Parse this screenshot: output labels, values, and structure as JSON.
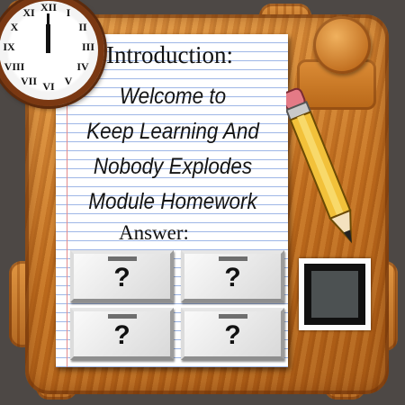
{
  "clock": {
    "numerals": [
      "XII",
      "I",
      "II",
      "III",
      "IV",
      "V",
      "VI",
      "VII",
      "VIII",
      "IX",
      "X",
      "XI"
    ]
  },
  "title": "Introduction:",
  "module_lines": [
    "Welcome to",
    "Keep Learning And",
    "Nobody Explodes",
    "Module Homework"
  ],
  "answer_label": "Answer:",
  "answers": [
    {
      "glyph": "?"
    },
    {
      "glyph": "?"
    },
    {
      "glyph": "?"
    },
    {
      "glyph": "?"
    }
  ],
  "colors": {
    "wood": "#c4701e",
    "status_light": "#4c5152",
    "pencil_body": "#f2c13a",
    "clock_rim": "#7a3812"
  },
  "icons": {
    "clock": "wall-clock-icon",
    "pencil": "pencil-icon",
    "status": "status-light-icon"
  }
}
